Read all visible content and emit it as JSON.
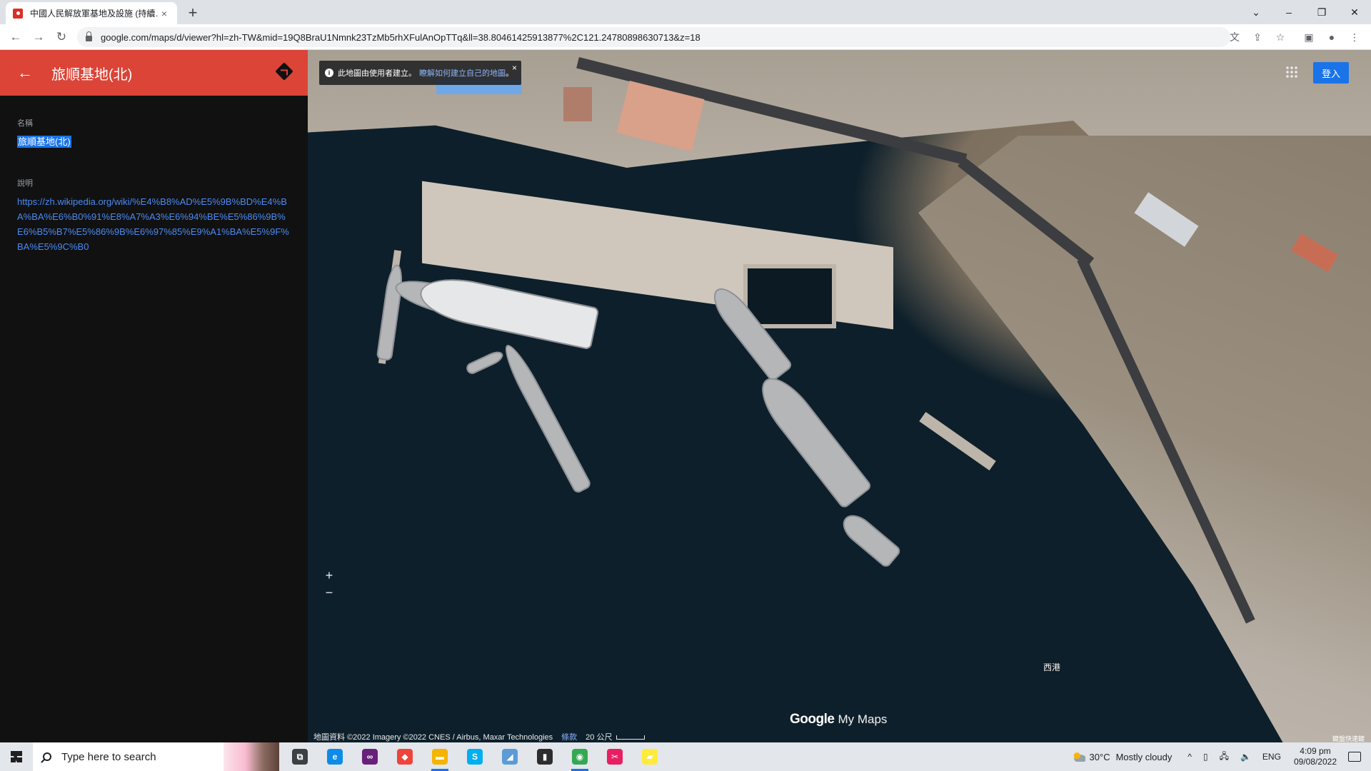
{
  "browser": {
    "tab_title": "中國人民解放軍基地及設施 (持續…",
    "tab_close": "×",
    "new_tab": "+",
    "url": "google.com/maps/d/viewer?hl=zh-TW&mid=19Q8BraU1Nmnk23TzMb5rhXFulAnOpTTq&ll=38.80461425913877%2C121.24780898630713&z=18",
    "nav_back": "←",
    "nav_forward": "→",
    "nav_reload": "↻",
    "window_controls": {
      "tabsearch": "⌄",
      "minimize": "–",
      "restore": "❐",
      "close": "✕"
    },
    "toolbar_icons": {
      "translate": "文",
      "share": "⇪",
      "bookmark": "☆",
      "sidepanel": "▣",
      "profile": "●",
      "menu": "⋮"
    }
  },
  "panel": {
    "back": "←",
    "title": "旅順基地(北)",
    "name_label": "名稱",
    "name_value": "旅順基地(北)",
    "desc_label": "說明",
    "desc_link": "https://zh.wikipedia.org/wiki/%E4%B8%AD%E5%9B%BD%E4%BA%BA%E6%B0%91%E8%A7%A3%E6%94%BE%E5%86%9B%E6%B5%B7%E5%86%9B%E6%97%85%E9%A1%BA%E5%9F%BA%E5%9C%B0"
  },
  "map": {
    "info_text": "此地圖由使用者建立。",
    "info_link": "瞭解如何建立自己的地圖",
    "info_dot": "。",
    "info_close": "×",
    "signin": "登入",
    "zoom_in": "+",
    "zoom_out": "−",
    "harbor_label": "西港",
    "brand_google": "Google",
    "brand_mymaps": "My Maps",
    "attribution": "地圖資料 ©2022 Imagery ©2022 CNES / Airbus, Maxar Technologies",
    "terms": "條款",
    "scale": "20 公尺",
    "corner_label": "鍵盤快速鍵"
  },
  "taskbar": {
    "search_placeholder": "Type here to search",
    "apps": [
      {
        "name": "task-view",
        "glyph": "⧉",
        "color": "#3c4043"
      },
      {
        "name": "edge",
        "glyph": "e",
        "color": "#0c8ce9"
      },
      {
        "name": "visual-studio",
        "glyph": "∞",
        "color": "#68217a"
      },
      {
        "name": "anydesk",
        "glyph": "◆",
        "color": "#ef443b"
      },
      {
        "name": "file-explorer",
        "glyph": "▬",
        "color": "#f4b400"
      },
      {
        "name": "skype",
        "glyph": "S",
        "color": "#00aff0"
      },
      {
        "name": "unknown-app",
        "glyph": "◢",
        "color": "#5c9bd6"
      },
      {
        "name": "terminal",
        "glyph": "▮",
        "color": "#2d2d2d"
      },
      {
        "name": "chrome",
        "glyph": "◉",
        "color": "#34a853"
      },
      {
        "name": "snipping-tool",
        "glyph": "✂",
        "color": "#e91e63"
      },
      {
        "name": "sticky-notes",
        "glyph": "▰",
        "color": "#ffeb3b"
      }
    ],
    "temperature": "30°C",
    "weather": "Mostly cloudy",
    "tray_caret": "^",
    "language": "ENG",
    "time": "4:09 pm",
    "date": "09/08/2022"
  }
}
